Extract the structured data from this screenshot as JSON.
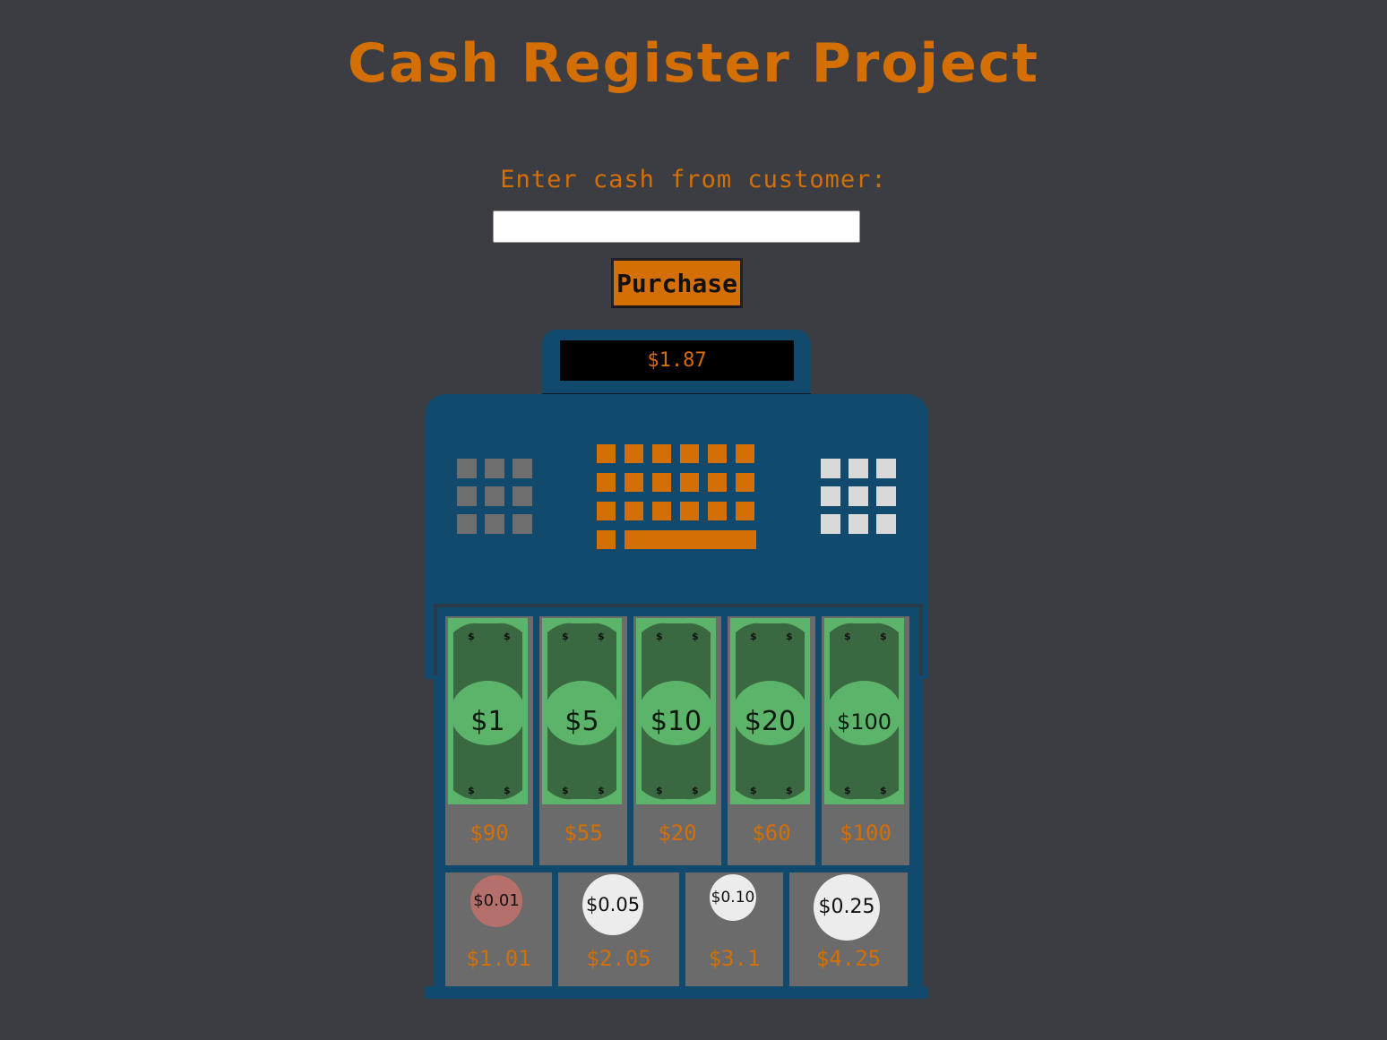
{
  "title": "Cash Register Project",
  "form": {
    "label": "Enter cash from customer:",
    "input_value": "",
    "purchase_label": "Purchase"
  },
  "display": {
    "price": "$1.87"
  },
  "colors": {
    "background": "#3b3d42",
    "accent": "#d46f06",
    "register": "#124a6e",
    "drawer_slot": "#6b6b6b",
    "bill_light": "#5cb36a",
    "bill_dark": "#3a6840",
    "penny": "#b5706b",
    "silver_coin": "#ececec"
  },
  "bills": [
    {
      "label": "$1",
      "amount": "$90",
      "icon": "dollar-bill-icon"
    },
    {
      "label": "$5",
      "amount": "$55",
      "icon": "dollar-bill-icon"
    },
    {
      "label": "$10",
      "amount": "$20",
      "icon": "dollar-bill-icon"
    },
    {
      "label": "$20",
      "amount": "$60",
      "icon": "dollar-bill-icon"
    },
    {
      "label": "$100",
      "amount": "$100",
      "icon": "dollar-bill-icon"
    }
  ],
  "coins": [
    {
      "label": "$0.01",
      "amount": "$1.01",
      "icon": "penny-icon"
    },
    {
      "label": "$0.05",
      "amount": "$2.05",
      "icon": "nickel-icon"
    },
    {
      "label": "$0.10",
      "amount": "$3.1",
      "icon": "dime-icon"
    },
    {
      "label": "$0.25",
      "amount": "$4.25",
      "icon": "quarter-icon"
    }
  ],
  "keypads": {
    "left_icon": "keypad-grey-icon",
    "center_icon": "keypad-orange-icon",
    "right_icon": "keypad-white-icon"
  }
}
